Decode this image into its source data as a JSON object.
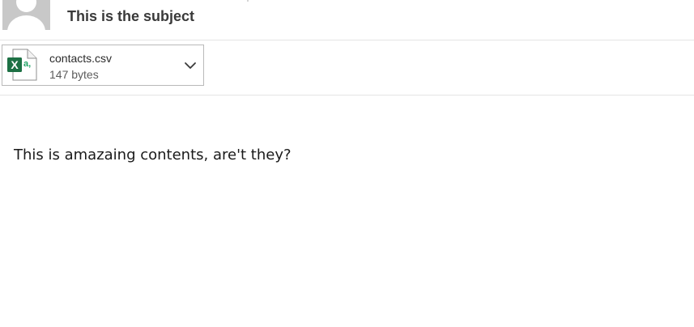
{
  "message": {
    "subject": "This is the subject",
    "body": "This is amazaing contents, are't they?"
  },
  "sender": {
    "avatar_icon": "default-person-avatar"
  },
  "attachment": {
    "file_name": "contacts.csv",
    "file_size": "147 bytes",
    "file_icon": "excel-csv-file-icon",
    "icon_letters": "X",
    "icon_badge": "a,",
    "menu_icon": "chevron-down-icon"
  },
  "colors": {
    "excel_green": "#1d7044",
    "excel_light_green": "#21a366",
    "avatar_gray": "#c8c8c8",
    "divider": "#e4e4e4"
  }
}
